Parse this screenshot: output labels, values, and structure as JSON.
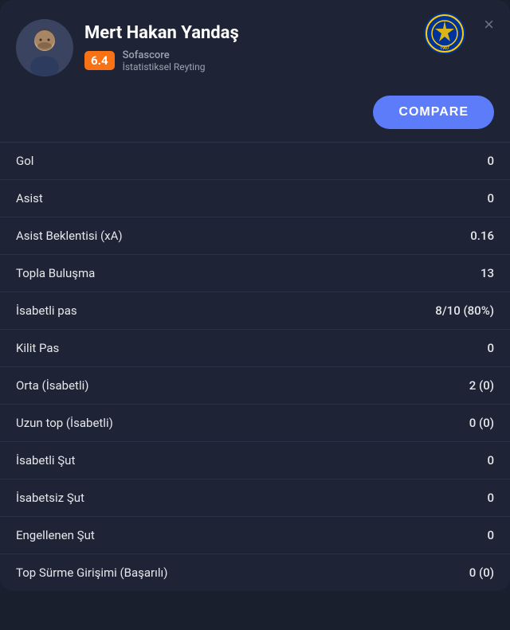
{
  "header": {
    "close_label": "×",
    "player_name": "Mert Hakan Yandaş",
    "rating": "6.4",
    "rating_source": "Sofascore",
    "rating_sublabel": "İstatistiksel Reyting",
    "compare_label": "COMPARE"
  },
  "stats": [
    {
      "label": "Gol",
      "value": "0"
    },
    {
      "label": "Asist",
      "value": "0"
    },
    {
      "label": "Asist Beklentisi (xA)",
      "value": "0.16"
    },
    {
      "label": "Topla Buluşma",
      "value": "13"
    },
    {
      "label": "İsabetli pas",
      "value": "8/10 (80%)"
    },
    {
      "label": "Kilit Pas",
      "value": "0"
    },
    {
      "label": "Orta (İsabetli)",
      "value": "2 (0)"
    },
    {
      "label": "Uzun top (İsabetli)",
      "value": "0 (0)"
    },
    {
      "label": "İsabetli Şut",
      "value": "0"
    },
    {
      "label": "İsabetsiz Şut",
      "value": "0"
    },
    {
      "label": "Engellenen Şut",
      "value": "0"
    },
    {
      "label": "Top Sürme Girişimi (Başarılı)",
      "value": "0 (0)"
    }
  ]
}
